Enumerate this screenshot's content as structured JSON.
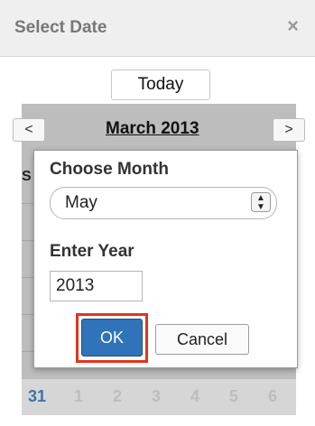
{
  "dialog": {
    "title": "Select Date",
    "close_icon": "×",
    "today_label": "Today"
  },
  "calendar": {
    "prev_label": "<",
    "next_label": ">",
    "month_title": "March 2013",
    "peek_left": "S",
    "peek_right": ":",
    "week": [
      "31",
      "1",
      "2",
      "3",
      "4",
      "5",
      "6"
    ]
  },
  "popup": {
    "month_label": "Choose Month",
    "month_value": "May",
    "year_label": "Enter Year",
    "year_value": "2013",
    "ok_label": "OK",
    "cancel_label": "Cancel"
  },
  "colors": {
    "ok_button": "#2f73b8",
    "highlight_outline": "#e3341b",
    "active_day": "#3f74a8"
  }
}
